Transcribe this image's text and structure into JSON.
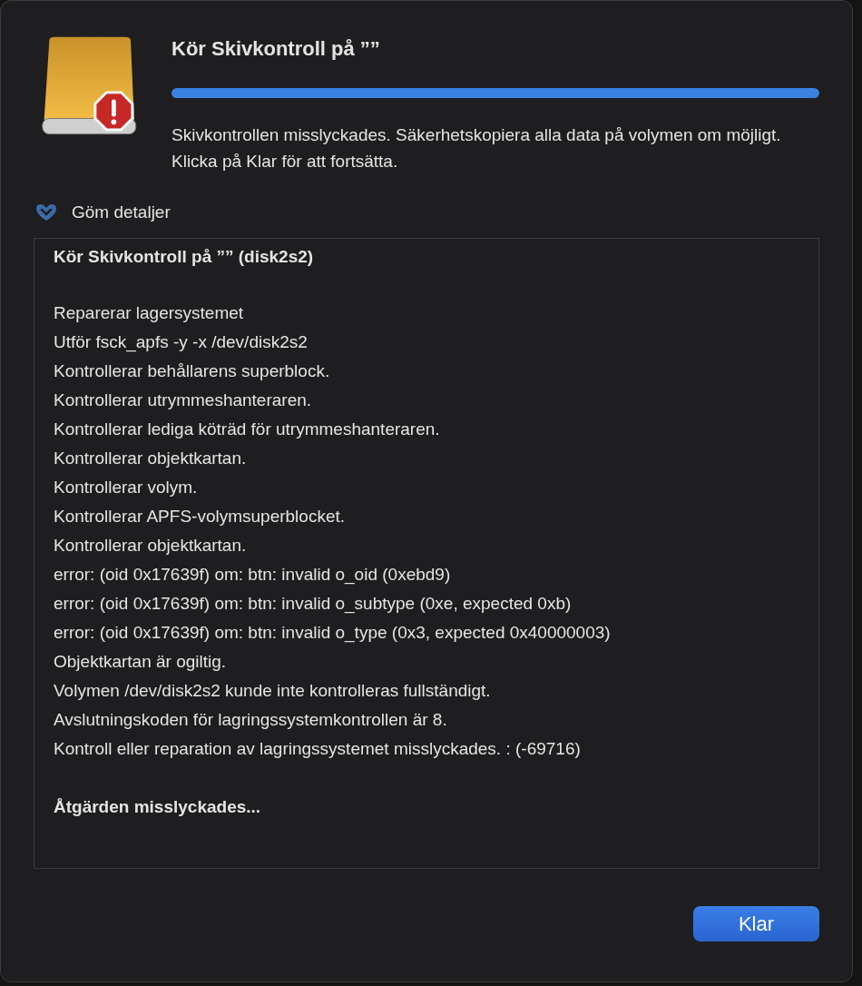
{
  "dialog": {
    "title": "Kör Skivkontroll på ””",
    "progress": {
      "level": 1
    },
    "message": "Skivkontrollen misslyckades. Säkerhetskopiera alla data på volymen om möjligt. Klicka på Klar för att fortsätta."
  },
  "details_toggle": {
    "label": "Göm detaljer",
    "expanded": true
  },
  "log": {
    "title": "Kör Skivkontroll på ”” (disk2s2)",
    "lines": [
      "Reparerar lagersystemet",
      "Utför fsck_apfs -y -x /dev/disk2s2",
      "Kontrollerar behållarens superblock.",
      "Kontrollerar utrymmeshanteraren.",
      "Kontrollerar lediga köträd för utrymmeshanteraren.",
      "Kontrollerar objektkartan.",
      "Kontrollerar volym.",
      "Kontrollerar APFS-volymsuperblocket.",
      "Kontrollerar objektkartan.",
      "error: (oid 0x17639f) om: btn: invalid o_oid (0xebd9)",
      "error: (oid 0x17639f) om: btn: invalid o_subtype (0xe, expected 0xb)",
      "error: (oid 0x17639f) om: btn: invalid o_type (0x3, expected 0x40000003)",
      "Objektkartan är ogiltig.",
      "Volymen /dev/disk2s2 kunde inte kontrolleras fullständigt.",
      "Avslutningskoden för lagringssystemkontrollen är 8.",
      "Kontroll eller reparation av lagringssystemet misslyckades. : (-69716)"
    ],
    "result": "Åtgärden misslyckades..."
  },
  "buttons": [
    {
      "label": "Klar",
      "default": true
    }
  ]
}
